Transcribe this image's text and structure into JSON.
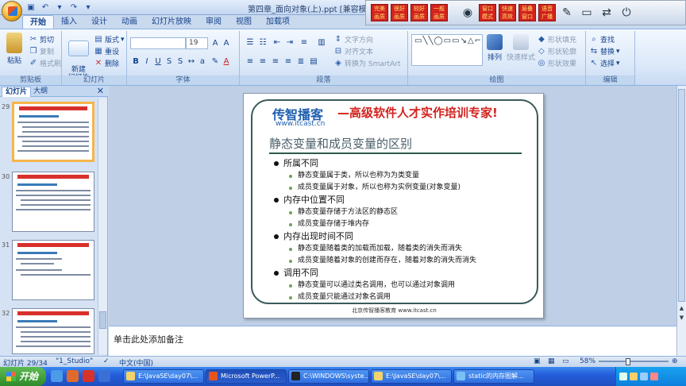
{
  "window": {
    "title": "第四章_面向对象(上).ppt [兼容模式]"
  },
  "tray_toolbar": {
    "buttons": [
      "完美画质",
      "很好画质",
      "较好画质",
      "一般画质"
    ],
    "buttons2": [
      "窗口模式",
      "快速高效",
      "层叠窗口",
      "语音广播"
    ]
  },
  "ribbon_tabs": [
    "开始",
    "插入",
    "设计",
    "动画",
    "幻灯片放映",
    "审阅",
    "视图",
    "加载项"
  ],
  "ribbon": {
    "clipboard": {
      "paste": "粘贴",
      "cut": "剪切",
      "copy": "复制",
      "format_painter": "格式刷",
      "label": "剪贴板"
    },
    "slides": {
      "new_slide": "新建\n幻灯片",
      "layout": "版式",
      "reset": "重设",
      "delete": "删除",
      "label": "幻灯片"
    },
    "font": {
      "name": "",
      "size": "19",
      "label": "字体"
    },
    "paragraph": {
      "text_direction": "文字方向",
      "align_text": "对齐文本",
      "smartart": "转换为 SmartArt",
      "label": "段落"
    },
    "drawing": {
      "arrange": "排列",
      "quick_styles": "快速样式",
      "shape_fill": "形状填充",
      "shape_outline": "形状轮廓",
      "shape_effects": "形状效果",
      "label": "绘图"
    },
    "editing": {
      "find": "查找",
      "replace": "替换",
      "select": "选择",
      "label": "编辑"
    }
  },
  "panel": {
    "tab_slides": "幻灯片",
    "tab_outline": "大纲",
    "thumb_numbers": [
      "29",
      "30",
      "31",
      "32"
    ]
  },
  "slide": {
    "logo_main": "传智播客",
    "logo_url": "www.itcast.cn",
    "slogan": "—高级软件人才实作培训专家!",
    "title": "静态变量和成员变量的区别",
    "bullets": [
      {
        "text": "所属不同",
        "subs": [
          "静态变量属于类，所以也称为为类变量",
          "成员变量属于对象，所以也称为实例变量(对象变量)"
        ]
      },
      {
        "text": "内存中位置不同",
        "subs": [
          "静态变量存储于方法区的静态区",
          "成员变量存储于堆内存"
        ]
      },
      {
        "text": "内存出现时间不同",
        "subs": [
          "静态变量随着类的加载而加载，随着类的消失而消失",
          "成员变量随着对象的创建而存在，随着对象的消失而消失"
        ]
      },
      {
        "text": "调用不同",
        "subs": [
          "静态变量可以通过类名调用，也可以通过对象调用",
          "成员变量只能通过对象名调用"
        ]
      }
    ],
    "footer": "北京传智播客教育 www.itcast.cn"
  },
  "notes": {
    "placeholder": "单击此处添加备注"
  },
  "status": {
    "slide_pos": "幻灯片 29/34",
    "theme": "\"1_Studio\"",
    "language": "中文(中国)",
    "zoom": "58%"
  },
  "taskbar": {
    "start": "开始",
    "tasks": [
      "E:\\JavaSE\\day07\\...",
      "Microsoft PowerP...",
      "C:\\WINDOWS\\syste...",
      "E:\\JavaSE\\day07\\...",
      "static的内存图解..."
    ]
  }
}
